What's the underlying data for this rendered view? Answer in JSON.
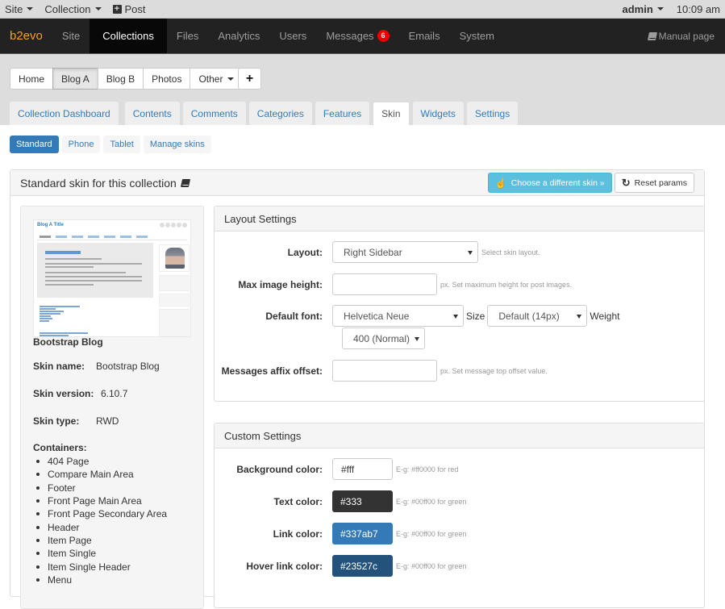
{
  "evobar": {
    "site": "Site",
    "collection": "Collection",
    "post": "Post",
    "user": "admin",
    "time": "10:09 am"
  },
  "navbar": {
    "brand": "b2evo",
    "items": [
      {
        "label": "Site"
      },
      {
        "label": "Collections",
        "active": true
      },
      {
        "label": "Files"
      },
      {
        "label": "Analytics"
      },
      {
        "label": "Users"
      },
      {
        "label": "Messages",
        "badge": "6"
      },
      {
        "label": "Emails"
      },
      {
        "label": "System"
      }
    ],
    "manual": "Manual page"
  },
  "collections": {
    "buttons": [
      "Home",
      "Blog A",
      "Blog B",
      "Photos",
      "Other"
    ],
    "active": "Blog A",
    "add_label": "+"
  },
  "tabs": [
    "Collection Dashboard",
    "Contents",
    "Comments",
    "Categories",
    "Features",
    "Skin",
    "Widgets",
    "Settings"
  ],
  "active_tab": "Skin",
  "pills": [
    "Standard",
    "Phone",
    "Tablet",
    "Manage skins"
  ],
  "active_pill": "Standard",
  "panel": {
    "title": "Standard skin for this collection",
    "choose_button": "Choose a different skin »",
    "reset_button": "Reset params"
  },
  "skin": {
    "preview": {
      "blog_title": "Blog A Title",
      "welcome": "Welcome to Blog A",
      "recent_posts": "Recent Posts",
      "recent_comments": "Recent Comments"
    },
    "display_name": "Bootstrap Blog",
    "name_label": "Skin name:",
    "name": "Bootstrap Blog",
    "version_label": "Skin version:",
    "version": "6.10.7",
    "type_label": "Skin type:",
    "type": "RWD",
    "containers_label": "Containers:",
    "containers": [
      "404 Page",
      "Compare Main Area",
      "Footer",
      "Front Page Main Area",
      "Front Page Secondary Area",
      "Header",
      "Item Page",
      "Item Single",
      "Item Single Header",
      "Menu"
    ]
  },
  "layout_settings": {
    "title": "Layout Settings",
    "layout_label": "Layout:",
    "layout_value": "Right Sidebar",
    "layout_note": "Select skin layout.",
    "max_img_label": "Max image height:",
    "max_img_value": "",
    "max_img_note": "px. Set maximum height for post images.",
    "font_label": "Default font:",
    "font_value": "Helvetica Neue",
    "size_label": "Size",
    "size_value": "Default (14px)",
    "weight_label": "Weight",
    "weight_value": "400 (Normal)",
    "affix_label": "Messages affix offset:",
    "affix_value": "",
    "affix_note": "px. Set message top offset value."
  },
  "custom_settings": {
    "title": "Custom Settings",
    "colors": [
      {
        "label": "Background color:",
        "value": "#fff",
        "bg": "#ffffff",
        "fg": "#333333",
        "note": "E-g: #ff0000 for red"
      },
      {
        "label": "Text color:",
        "value": "#333",
        "bg": "#333333",
        "fg": "#ffffff",
        "note": "E-g: #00ff00 for green"
      },
      {
        "label": "Link color:",
        "value": "#337ab7",
        "bg": "#337ab7",
        "fg": "#ffffff",
        "note": "E-g: #00ff00 for green"
      },
      {
        "label": "Hover link color:",
        "value": "#23527c",
        "bg": "#23527c",
        "fg": "#ffffff",
        "note": "E-g: #00ff00 for green"
      }
    ]
  },
  "colors": {
    "brand": "#f5a01d",
    "primary": "#337ab7",
    "info": "#5bc0de",
    "badge": "#ee0000"
  }
}
